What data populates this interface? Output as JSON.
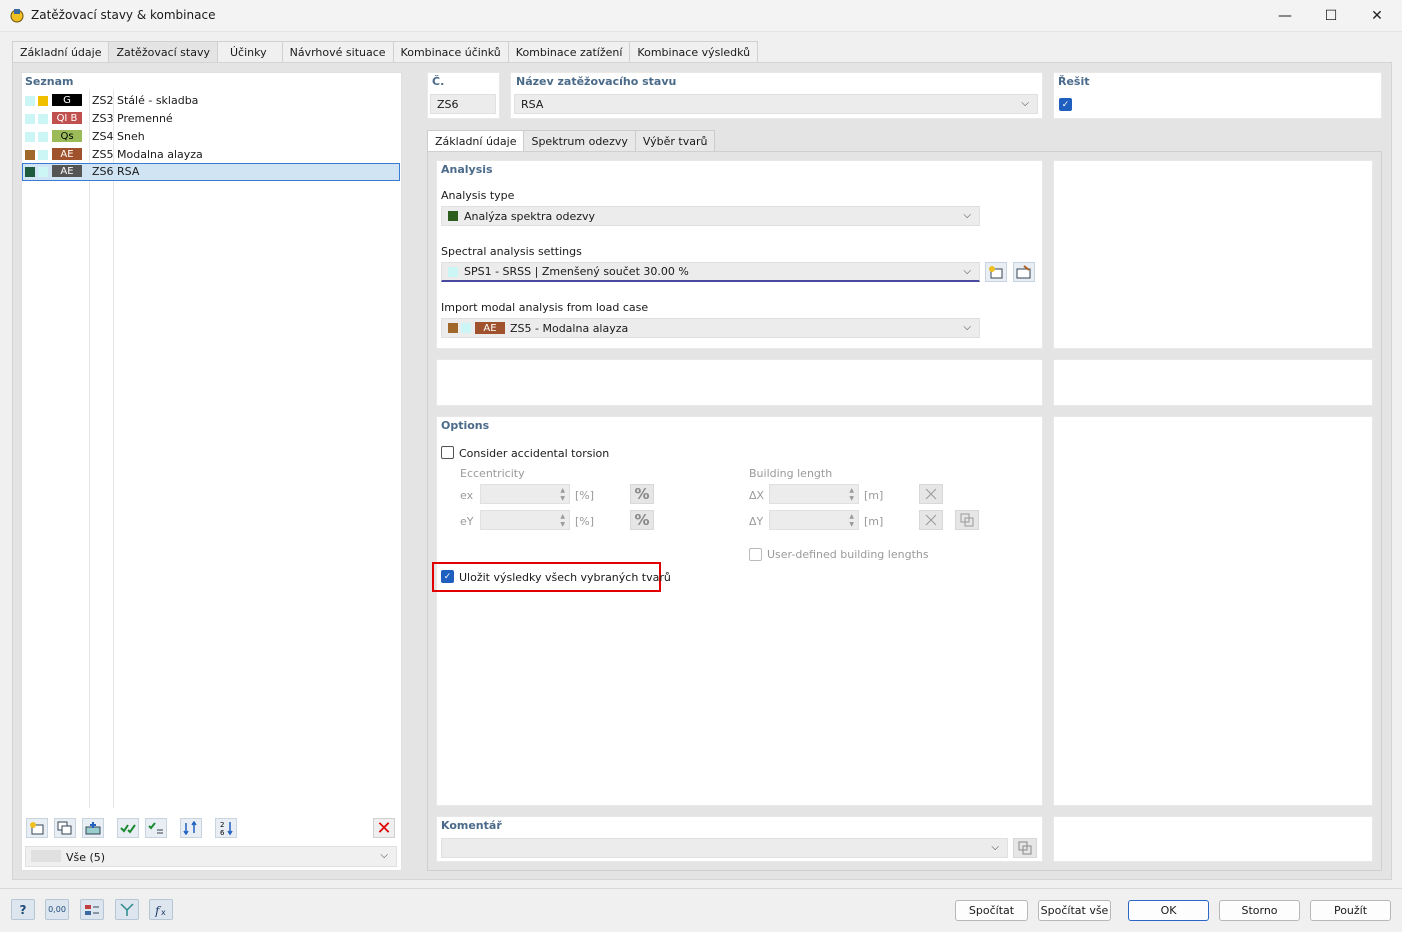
{
  "window": {
    "title": "Zatěžovací stavy & kombinace",
    "minimize": "—",
    "maximize": "☐",
    "close": "✕"
  },
  "top_tabs": [
    {
      "label": "Základní údaje"
    },
    {
      "label": "Zatěžovací stavy",
      "active": true
    },
    {
      "label": "Účinky"
    },
    {
      "label": "Návrhové situace"
    },
    {
      "label": "Kombinace účinků"
    },
    {
      "label": "Kombinace zatížení"
    },
    {
      "label": "Kombinace výsledků"
    }
  ],
  "list": {
    "heading": "Seznam",
    "rows": [
      {
        "badge": "G",
        "code": "ZS2",
        "name": "Stálé - skladba",
        "color1": "#ccf5f5",
        "color2": "#f0c000",
        "badge_bg": "#000000",
        "badge_fg": "#ffffff"
      },
      {
        "badge": "QI B",
        "code": "ZS3",
        "name": "Premenné",
        "color1": "#ccf5f5",
        "color2": "#ccf5f5",
        "badge_bg": "#c0504d",
        "badge_fg": "#ffffff"
      },
      {
        "badge": "Qs",
        "code": "ZS4",
        "name": "Sneh",
        "color1": "#ccf5f5",
        "color2": "#ccf5f5",
        "badge_bg": "#9bbb59",
        "badge_fg": "#000000"
      },
      {
        "badge": "AE",
        "code": "ZS5",
        "name": "Modalna alayza",
        "color1": "#a0682a",
        "color2": "#ccf5f5",
        "badge_bg": "#a0522d",
        "badge_fg": "#ffffff"
      },
      {
        "badge": "AE",
        "code": "ZS6",
        "name": "RSA",
        "color1": "#1e5a3c",
        "color2": "#ccf5f5",
        "badge_bg": "#555555",
        "badge_fg": "#ffffff",
        "selected": true
      }
    ],
    "filter": "Vše (5)"
  },
  "header": {
    "no_label": "Č.",
    "no_value": "ZS6",
    "name_label": "Název zatěžovacího stavu",
    "name_value": "RSA",
    "solve_label": "Řešit",
    "solve_checked": true
  },
  "inner_tabs": [
    {
      "label": "Základní údaje",
      "active": true
    },
    {
      "label": "Spektrum odezvy"
    },
    {
      "label": "Výběr tvarů"
    }
  ],
  "analysis": {
    "heading": "Analysis",
    "type_label": "Analysis type",
    "type_value": "Analýza spektra odezvy",
    "type_color": "#2e5e1e",
    "spectral_label": "Spectral analysis settings",
    "spectral_value": "SPS1 - SRSS | Zmenšený součet 30.00 %",
    "spectral_color": "#ccf5f5",
    "import_label": "Import modal analysis from load case",
    "import_badge": "AE",
    "import_value": "ZS5 - Modalna alayza"
  },
  "options": {
    "heading": "Options",
    "torsion_label": "Consider accidental torsion",
    "torsion_checked": false,
    "eccentricity_label": "Eccentricity",
    "ex_label": "ex",
    "ey_label": "eY",
    "pct_unit": "[%]",
    "pct_symbol": "%",
    "building_length_label": "Building length",
    "dx_label": "ΔX",
    "dy_label": "ΔY",
    "m_unit": "[m]",
    "user_defined_label": "User-defined building lengths",
    "user_defined_checked": false,
    "save_results_label": "Uložit výsledky všech vybraných tvarů",
    "save_results_checked": true
  },
  "comment": {
    "heading": "Komentář",
    "value": ""
  },
  "buttons": {
    "calculate": "Spočítat",
    "calculate_all": "Spočítat vše",
    "ok": "OK",
    "cancel": "Storno",
    "apply": "Použít"
  },
  "tool_icons": {
    "help": "?",
    "units": "0,00",
    "delete": "✕"
  },
  "highlight_color": "#e00000"
}
